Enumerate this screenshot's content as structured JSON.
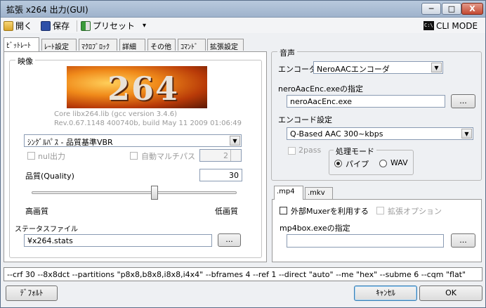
{
  "window": {
    "title": "拡張 x264 出力(GUI)",
    "min": "─",
    "max": "□",
    "close": "X"
  },
  "toolbar": {
    "open": "開く",
    "save": "保存",
    "preset": "プリセット",
    "preset_arrow": "▾",
    "cli_mode": "CLI MODE",
    "cli_icon": "C:\\"
  },
  "tabs": [
    "ﾋﾞｯﾄﾚｰﾄ",
    "ﾚｰﾄ設定",
    "ﾏｸﾛﾌﾞﾛｯｸ",
    "詳細",
    "その他",
    "ｺﾏﾝﾄﾞ",
    "拡張設定"
  ],
  "video": {
    "legend": "映像",
    "logo_text": "264",
    "core_line": "Core libx264.lib (gcc version 3.4.6)",
    "rev_line": "Rev.0.67.1148 400740b, build May 11 2009 01:06:49",
    "mode_select": "ｼﾝｸﾞﾙﾊﾟｽ - 品質基準VBR",
    "nul_label": "nul出力",
    "auto_multipass_label": "自動マルチパス",
    "multipass_value": "2",
    "quality_label": "品質(Quality)",
    "quality_value": "30",
    "quality_level": 0.6,
    "high_label": "高画質",
    "low_label": "低画質",
    "stats_label": "ステータスファイル",
    "stats_value": "¥x264.stats",
    "browse": "..."
  },
  "audio": {
    "legend": "音声",
    "encoder_label": "エンコーダ",
    "encoder_value": "NeroAACエンコーダ",
    "exe_label": "neroAacEnc.exeの指定",
    "exe_value": "neroAacEnc.exe",
    "browse": "...",
    "encode_setting_label": "エンコード設定",
    "encode_setting_value": "Q-Based AAC 300~kbps",
    "twopass_label": "2pass",
    "mode_legend": "処理モード",
    "pipe_label": "パイプ",
    "wav_label": "WAV"
  },
  "mux": {
    "tabs": [
      ".mp4",
      ".mkv"
    ],
    "external_muxer_label": "外部Muxerを利用する",
    "ext_option_label": "拡張オプション",
    "mp4box_label": "mp4box.exeの指定",
    "mp4box_value": "",
    "browse": "..."
  },
  "cmdline": "--crf 30 --8x8dct --partitions \"p8x8,b8x8,i8x8,i4x4\" --bframes 4 --ref 1 --direct \"auto\" --me \"hex\" --subme 6 --cqm \"flat\"",
  "buttons": {
    "default": "ﾃﾞﾌｫﾙﾄ",
    "cancel": "ｷｬﾝｾﾙ",
    "ok": "OK"
  }
}
